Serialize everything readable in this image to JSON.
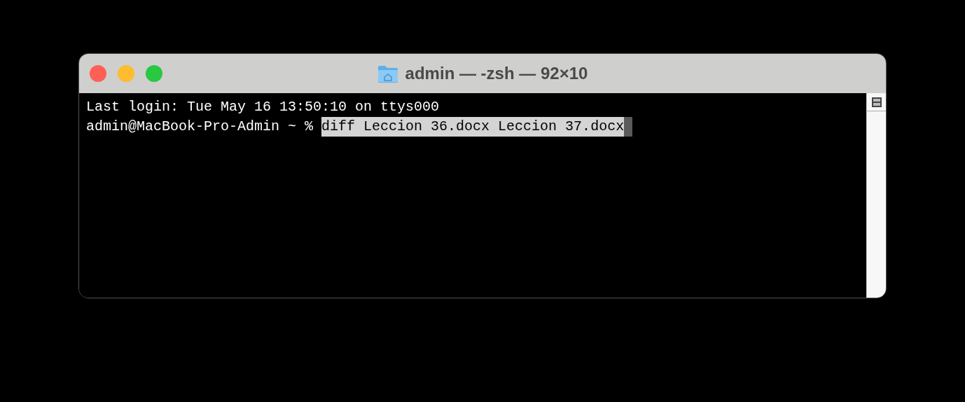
{
  "window": {
    "title": "admin — -zsh — 92×10"
  },
  "traffic_lights": [
    {
      "color": "#ff5f57"
    },
    {
      "color": "#febc2e"
    },
    {
      "color": "#28c840"
    }
  ],
  "terminal": {
    "lines": [
      {
        "kind": "output",
        "text": "Last login: Tue May 16 13:50:10 on ttys000"
      },
      {
        "kind": "prompt",
        "prompt": "admin@MacBook-Pro-Admin ~ %",
        "command": "diff Leccion 36.docx Leccion 37.docx",
        "selected": true,
        "cursor": true
      }
    ]
  }
}
